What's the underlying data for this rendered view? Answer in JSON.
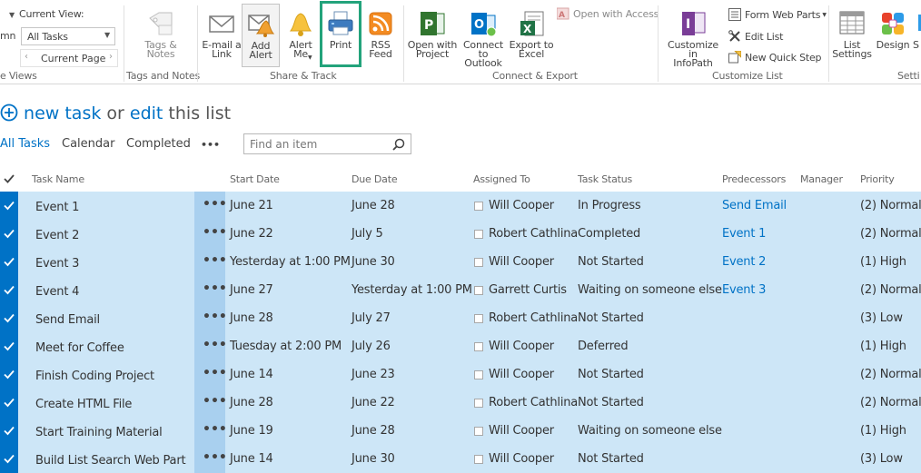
{
  "ribbon": {
    "manage_views": {
      "column_partial": "mn",
      "current_view_label": "Current View:",
      "current_view_value": "All Tasks",
      "current_page": "Current Page",
      "group_label": "e Views"
    },
    "tags": {
      "label": "Tags &\nNotes",
      "group_label": "Tags and Notes"
    },
    "share_track": {
      "email_link": "E-mail a\nLink",
      "add_alert": "Add\nAlert",
      "alert_me": "Alert\nMe",
      "print": "Print",
      "rss_feed": "RSS\nFeed",
      "group_label": "Share & Track"
    },
    "connect_export": {
      "open_with_project": "Open with\nProject",
      "connect_outlook": "Connect to\nOutlook",
      "export_excel": "Export to\nExcel",
      "open_with_access": "Open with Access",
      "group_label": "Connect & Export"
    },
    "customize_list": {
      "customize_infopath": "Customize in\nInfoPath",
      "form_web_parts": "Form Web Parts",
      "edit_list": "Edit List",
      "new_quick_step": "New Quick Step",
      "group_label": "Customize List"
    },
    "settings": {
      "list_settings": "List\nSettings",
      "design": "Design",
      "partial": "S",
      "group_label": "Setti"
    }
  },
  "page": {
    "new_task_link": "new task",
    "or_text": "or",
    "edit_link": "edit",
    "this_list_text": "this list",
    "views": {
      "all_tasks": "All Tasks",
      "calendar": "Calendar",
      "completed": "Completed",
      "more": "•••"
    },
    "search_placeholder": "Find an item"
  },
  "table": {
    "columns": [
      "Task Name",
      "Start Date",
      "Due Date",
      "Assigned To",
      "Task Status",
      "Predecessors",
      "Manager",
      "Priority"
    ],
    "rows": [
      {
        "name": "Event 1",
        "start": "June 21",
        "due": "June 28",
        "assigned": "Will Cooper",
        "status": "In Progress",
        "pred": "Send Email",
        "priority": "(2) Normal"
      },
      {
        "name": "Event 2",
        "start": "June 22",
        "due": "July 5",
        "assigned": "Robert Cathlina",
        "status": "Completed",
        "pred": "Event 1",
        "priority": "(2) Normal"
      },
      {
        "name": "Event 3",
        "start": "Yesterday at 1:00 PM",
        "due": "June 30",
        "assigned": "Will Cooper",
        "status": "Not Started",
        "pred": "Event 2",
        "priority": "(1) High"
      },
      {
        "name": "Event 4",
        "start": "June 27",
        "due": "Yesterday at 1:00 PM",
        "assigned": "Garrett Curtis",
        "status": "Waiting on someone else",
        "pred": "Event 3",
        "priority": "(2) Normal"
      },
      {
        "name": "Send Email",
        "start": "June 28",
        "due": "July 27",
        "assigned": "Robert Cathlina",
        "status": "Not Started",
        "pred": "",
        "priority": "(3) Low"
      },
      {
        "name": "Meet for Coffee",
        "start": "Tuesday at 2:00 PM",
        "due": "July 26",
        "assigned": "Will Cooper",
        "status": "Deferred",
        "pred": "",
        "priority": "(1) High"
      },
      {
        "name": "Finish Coding Project",
        "start": "June 14",
        "due": "June 23",
        "assigned": "Will Cooper",
        "status": "Not Started",
        "pred": "",
        "priority": "(2) Normal"
      },
      {
        "name": "Create HTML File",
        "start": "June 28",
        "due": "June 22",
        "assigned": "Robert Cathlina",
        "status": "Not Started",
        "pred": "",
        "priority": "(2) Normal"
      },
      {
        "name": "Start Training Material",
        "start": "June 19",
        "due": "June 28",
        "assigned": "Will Cooper",
        "status": "Waiting on someone else",
        "pred": "",
        "priority": "(1) High"
      },
      {
        "name": "Build List Search Web Part",
        "start": "June 14",
        "due": "June 30",
        "assigned": "Will Cooper",
        "status": "Not Started",
        "pred": "",
        "priority": "(3) Low"
      }
    ],
    "row_ellipsis": "•••"
  },
  "colors": {
    "accent": "#0072c6",
    "selected_row": "#cde6f7",
    "highlight_border": "#23a37b"
  },
  "icons": [
    "chevron-down-icon",
    "tag-icon",
    "email-link-icon",
    "add-alert-icon",
    "alert-bell-icon",
    "print-icon",
    "rss-icon",
    "project-icon",
    "outlook-icon",
    "excel-icon",
    "access-icon",
    "infopath-icon",
    "form-web-parts-icon",
    "edit-list-icon",
    "quick-step-icon",
    "list-settings-icon",
    "design-icon",
    "plus-circle-icon",
    "search-icon",
    "checkmark-icon",
    "checkbox-icon"
  ]
}
